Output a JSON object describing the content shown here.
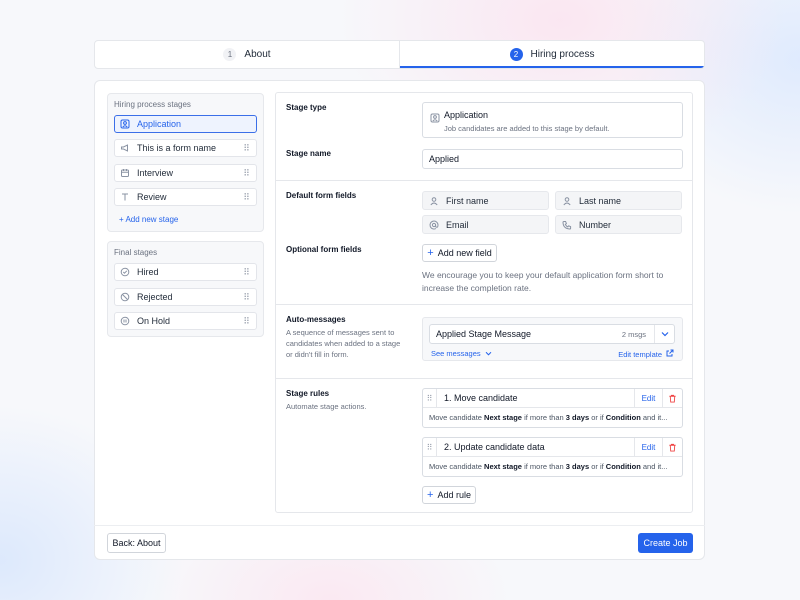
{
  "colors": {
    "accent": "#2563eb",
    "danger": "#ef4444",
    "muted": "#6b7280"
  },
  "stepper": [
    {
      "number": "1",
      "label": "About"
    },
    {
      "number": "2",
      "label": "Hiring process"
    }
  ],
  "sidebar": {
    "hiring_title": "Hiring process stages",
    "hiring_stages": [
      {
        "label": "Application",
        "icon": "user-icon"
      },
      {
        "label": "This is a form name",
        "icon": "megaphone-icon"
      },
      {
        "label": "Interview",
        "icon": "calendar-icon"
      },
      {
        "label": "Review",
        "icon": "text-icon"
      }
    ],
    "add_stage": "Add new stage",
    "final_title": "Final stages",
    "final_stages": [
      {
        "label": "Hired",
        "icon": "check-circle-icon"
      },
      {
        "label": "Rejected",
        "icon": "ban-icon"
      },
      {
        "label": "On Hold",
        "icon": "pause-circle-icon"
      }
    ]
  },
  "form": {
    "stage_type": {
      "label": "Stage type",
      "value": "Application",
      "description": "Job candidates are added to this stage by default."
    },
    "stage_name": {
      "label": "Stage name",
      "value": "Applied"
    },
    "default_fields": {
      "label": "Default form fields",
      "fields": [
        "First name",
        "Last name",
        "Email",
        "Number"
      ]
    },
    "optional_fields": {
      "label": "Optional form fields",
      "button": "Add new field",
      "hint": "We encourage you to keep your default application form short to increase the completion rate."
    },
    "auto_messages": {
      "label": "Auto-messages",
      "description": "A sequence of messages sent to candidates when added to a stage or didn't fill in form.",
      "selected": "Applied Stage Message",
      "count": "2 msgs",
      "see_messages": "See messages",
      "edit_template": "Edit template"
    },
    "stage_rules": {
      "label": "Stage rules",
      "description": "Automate stage actions.",
      "rules": [
        {
          "title": "1. Move candidate",
          "edit": "Edit",
          "d1": "Move candidate ",
          "d2": "Next stage",
          "d3": " if more than ",
          "d4": "3 days",
          "d5": " or if ",
          "d6": "Condition",
          "d7": " and it..."
        },
        {
          "title": "2. Update candidate data",
          "edit": "Edit",
          "d1": "Move candidate ",
          "d2": "Next stage",
          "d3": " if more than ",
          "d4": "3 days",
          "d5": " or if ",
          "d6": "Condition",
          "d7": " and it..."
        }
      ],
      "add_rule": "Add rule"
    }
  },
  "footer": {
    "back": "Back: About",
    "create": "Create Job"
  }
}
